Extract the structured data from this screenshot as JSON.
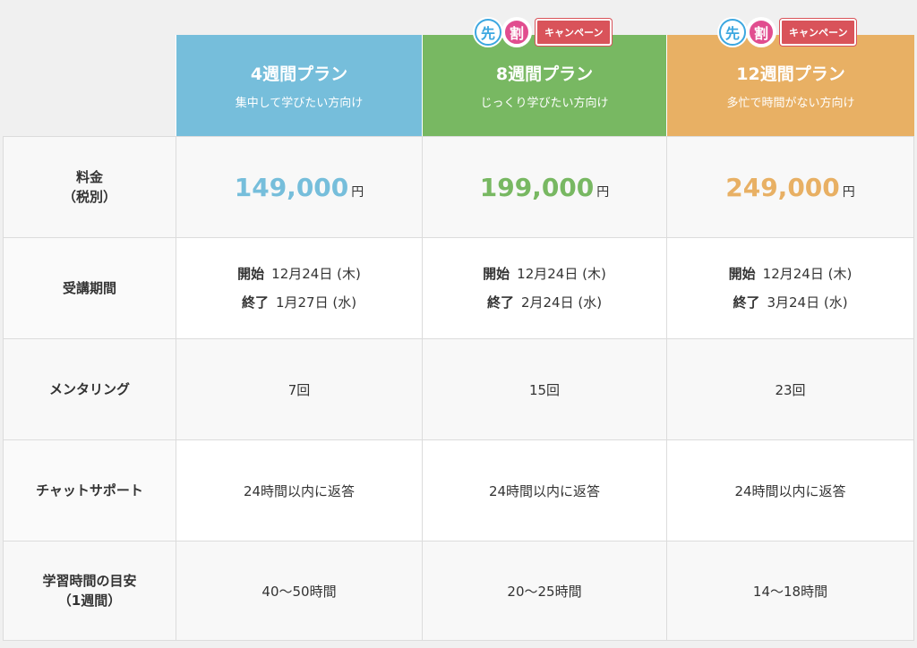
{
  "plans": [
    {
      "name": "4週間プラン",
      "sub": "集中して学びたい方向け",
      "promo": false,
      "price": "149,000",
      "unit": "円",
      "start_label": "開始",
      "start": "12月24日 (木)",
      "end_label": "終了",
      "end": "1月27日 (水)",
      "mentoring": "7回",
      "chat": "24時間以内に返答",
      "study": "40〜50時間"
    },
    {
      "name": "8週間プラン",
      "sub": "じっくり学びたい方向け",
      "promo": true,
      "price": "199,000",
      "unit": "円",
      "start_label": "開始",
      "start": "12月24日 (木)",
      "end_label": "終了",
      "end": "2月24日 (水)",
      "mentoring": "15回",
      "chat": "24時間以内に返答",
      "study": "20〜25時間"
    },
    {
      "name": "12週間プラン",
      "sub": "多忙で時間がない方向け",
      "promo": true,
      "price": "249,000",
      "unit": "円",
      "start_label": "開始",
      "start": "12月24日 (木)",
      "end_label": "終了",
      "end": "3月24日 (水)",
      "mentoring": "23回",
      "chat": "24時間以内に返答",
      "study": "14〜18時間"
    }
  ],
  "promo": {
    "char1": "先",
    "char2": "割",
    "badge": "キャンペーン"
  },
  "labels": {
    "price_l1": "料金",
    "price_l2": "（税別）",
    "period": "受講期間",
    "mentoring": "メンタリング",
    "chat": "チャットサポート",
    "study_l1": "学習時間の目安",
    "study_l2": "（1週間）"
  },
  "colors": {
    "plan1": "#76bedb",
    "plan2": "#78b862",
    "plan3": "#e8b064",
    "badge": "#d9535a"
  }
}
